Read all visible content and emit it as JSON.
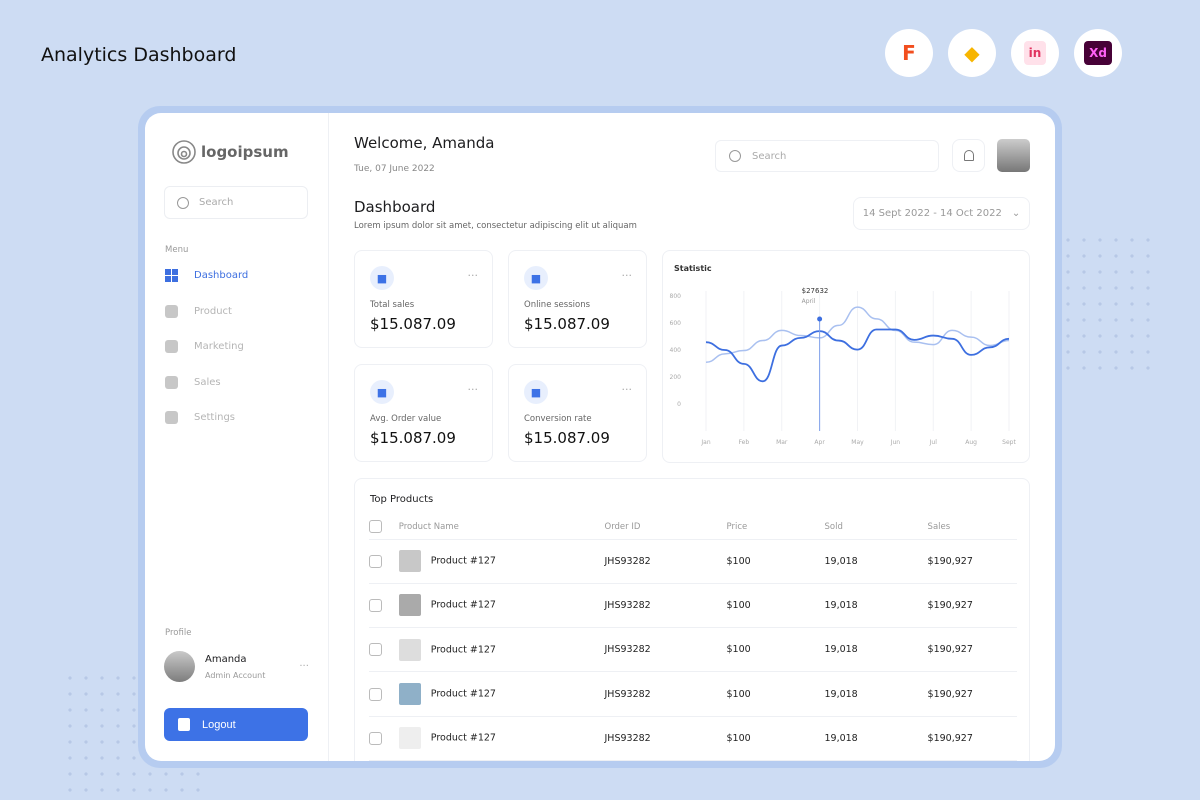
{
  "page_title": "Analytics Dashboard",
  "tools": [
    {
      "name": "figma",
      "label": "F",
      "color": "#f24e1e"
    },
    {
      "name": "sketch",
      "label": "◆",
      "color": "#f7b500"
    },
    {
      "name": "invision",
      "label": "in",
      "color": "#e1325f"
    },
    {
      "name": "xd",
      "label": "Xd",
      "color": "#ff61f6"
    }
  ],
  "sidebar": {
    "logo": "logoipsum",
    "search_placeholder": "Search",
    "menu_label": "Menu",
    "items": [
      {
        "label": "Dashboard",
        "icon": "grid-icon"
      },
      {
        "label": "Product",
        "icon": "bag-icon"
      },
      {
        "label": "Marketing",
        "icon": "megaphone-icon"
      },
      {
        "label": "Sales",
        "icon": "clipboard-icon"
      },
      {
        "label": "Settings",
        "icon": "gear-icon"
      }
    ],
    "profile_label": "Profile",
    "user_name": "Amanda",
    "user_role": "Admin Account",
    "logout": "Logout"
  },
  "header": {
    "welcome": "Welcome, Amanda",
    "date": "Tue, 07 June 2022",
    "search_placeholder": "Search"
  },
  "dashboard": {
    "title": "Dashboard",
    "subtitle": "Lorem ipsum dolor sit amet, consectetur adipiscing elit ut aliquam",
    "date_range": "14 Sept 2022 - 14 Oct 2022"
  },
  "stats": [
    {
      "label": "Total sales",
      "value": "$15.087.09",
      "icon": "basket-icon"
    },
    {
      "label": "Online sessions",
      "value": "$15.087.09",
      "icon": "share-icon"
    },
    {
      "label": "Avg. Order value",
      "value": "$15.087.09",
      "icon": "wallet-icon"
    },
    {
      "label": "Conversion rate",
      "value": "$15.087.09",
      "icon": "trophy-icon"
    }
  ],
  "chart_data": {
    "type": "line",
    "title": "Statistic",
    "categories": [
      "Jan",
      "Feb",
      "Mar",
      "Apr",
      "May",
      "Jun",
      "Jul",
      "Aug",
      "Sept"
    ],
    "x": [
      0,
      0.5,
      1,
      1.5,
      2,
      2.5,
      3,
      3.5,
      4,
      4.5,
      5,
      5.5,
      6,
      6.5,
      7,
      7.5,
      8
    ],
    "yticks": [
      0,
      200,
      400,
      600,
      800
    ],
    "ylim": [
      -300,
      800
    ],
    "series": [
      {
        "color": "#3d6fe0",
        "values": [
          458,
          400,
          297,
          168,
          433,
          490,
          540,
          470,
          403,
          552,
          552,
          475,
          507,
          483,
          364,
          420,
          483
        ]
      },
      {
        "color": "#a9c0f0",
        "values": [
          309,
          371,
          396,
          470,
          545,
          507,
          490,
          582,
          718,
          631,
          545,
          458,
          440,
          545,
          495,
          433,
          470
        ]
      }
    ],
    "tooltip": {
      "value": "$27632",
      "label": "April",
      "x": 3
    },
    "grid": "vertical"
  },
  "products": {
    "title": "Top Products",
    "columns": [
      "Product Name",
      "Order ID",
      "Price",
      "Sold",
      "Sales"
    ],
    "rows": [
      {
        "name": "Product #127",
        "order": "JHS93282",
        "price": "$100",
        "sold": "19,018",
        "sales": "$190,927"
      },
      {
        "name": "Product #127",
        "order": "JHS93282",
        "price": "$100",
        "sold": "19,018",
        "sales": "$190,927"
      },
      {
        "name": "Product #127",
        "order": "JHS93282",
        "price": "$100",
        "sold": "19,018",
        "sales": "$190,927"
      },
      {
        "name": "Product #127",
        "order": "JHS93282",
        "price": "$100",
        "sold": "19,018",
        "sales": "$190,927"
      },
      {
        "name": "Product #127",
        "order": "JHS93282",
        "price": "$100",
        "sold": "19,018",
        "sales": "$190,927"
      }
    ]
  }
}
